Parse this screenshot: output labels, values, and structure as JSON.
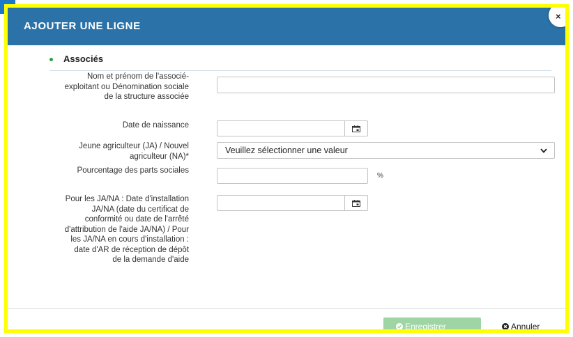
{
  "modal": {
    "title": "AJOUTER UNE LIGNE",
    "close_symbol": "×",
    "close_icon": "close-icon"
  },
  "section": {
    "title": "Associés",
    "accent_color": "#2e9e44"
  },
  "fields": {
    "name": {
      "label": "Nom et prénom de l'associé-exploitant ou Dénomination sociale de la structure associée",
      "value": ""
    },
    "birth_date": {
      "label": "Date de naissance",
      "value": "",
      "icon": "calendar-icon"
    },
    "status": {
      "label": "Jeune agriculteur (JA) / Nouvel agriculteur (NA)*",
      "selected": "Veuillez sélectionner une valeur",
      "icon": "chevron-down-icon"
    },
    "shares": {
      "label": "Pourcentage des parts sociales",
      "value": "",
      "unit": "%"
    },
    "install_date": {
      "label": "Pour les JA/NA : Date d'installation JA/NA (date du certificat de conformité ou date de l'arrêté d'attribution de l'aide JA/NA) / Pour les JA/NA en cours d'installation : date d'AR de réception de dépôt de la demande d'aide",
      "value": "",
      "icon": "calendar-icon"
    }
  },
  "footer": {
    "save_label": "Enregistrer",
    "save_icon": "check-circle-icon",
    "cancel_label": "Annuler",
    "cancel_icon": "times-circle-icon"
  },
  "colors": {
    "header": "#2a72a8",
    "frame_highlight": "#ffff00",
    "save_button": "#9fd4a4"
  }
}
